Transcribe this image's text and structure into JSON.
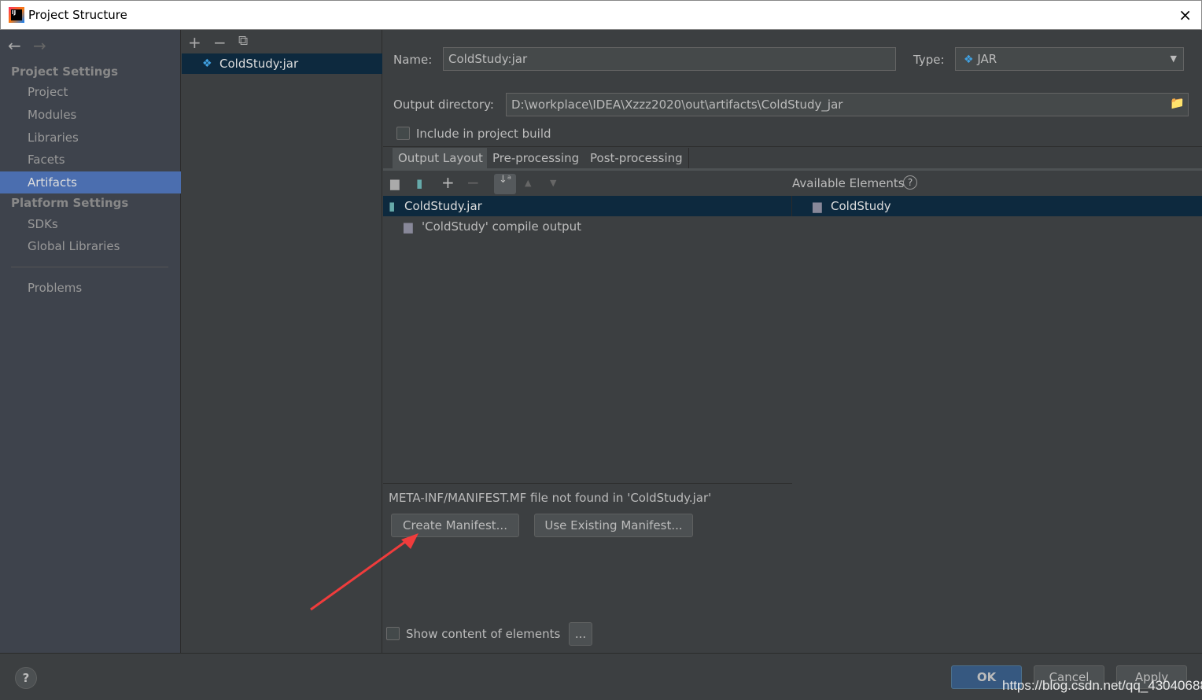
{
  "window": {
    "title": "Project Structure",
    "close_icon": "×"
  },
  "sidebar": {
    "back": "←",
    "forward": "→",
    "project_settings": "Project Settings",
    "items": [
      "Project",
      "Modules",
      "Libraries",
      "Facets",
      "Artifacts"
    ],
    "selected": "Artifacts",
    "platform_settings": "Platform Settings",
    "platform_items": [
      "SDKs",
      "Global Libraries"
    ],
    "problems": "Problems"
  },
  "artifacts_panel": {
    "add": "+",
    "remove": "−",
    "copy": "⧉",
    "items": [
      "ColdStudy:jar"
    ]
  },
  "editor": {
    "name_label": "Name:",
    "name_value": "ColdStudy:jar",
    "type_label": "Type:",
    "type_value": "JAR",
    "output_dir_label": "Output directory:",
    "output_dir_value": "D:\\workplace\\IDEA\\Xzzz2020\\out\\artifacts\\ColdStudy_jar",
    "include_build_label": "Include in project build",
    "include_build_checked": false,
    "tabs": [
      "Output Layout",
      "Pre-processing",
      "Post-processing"
    ],
    "active_tab": "Output Layout",
    "available_elements_label": "Available Elements",
    "layout_tree": [
      "ColdStudy.jar",
      "'ColdStudy' compile output"
    ],
    "available_tree": [
      "ColdStudy"
    ],
    "manifest_warning": "META-INF/MANIFEST.MF file not found in 'ColdStudy.jar'",
    "create_manifest": "Create Manifest...",
    "use_existing_manifest": "Use Existing Manifest...",
    "show_content_label": "Show content of elements",
    "show_content_checked": false,
    "more": "..."
  },
  "footer": {
    "help": "?",
    "ok": "OK",
    "cancel": "Cancel",
    "apply": "Apply"
  },
  "watermark": "https://blog.csdn.net/qq_43040688",
  "colors": {
    "selection": "#4b6eaf",
    "tree_selection": "#0d293e",
    "ok_button": "#365880",
    "annotation_arrow": "#f03c3c"
  }
}
